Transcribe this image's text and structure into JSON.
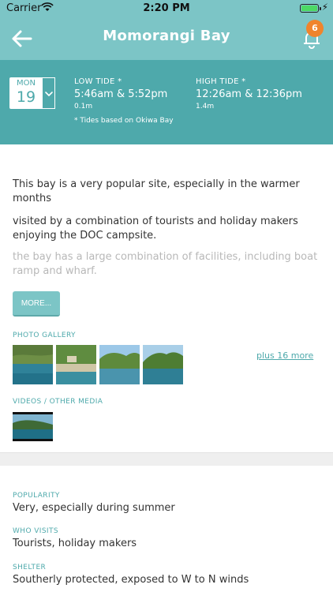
{
  "status_bar": {
    "carrier": "Carrier",
    "time": "2:20 PM"
  },
  "nav": {
    "title": "Momorangi Bay",
    "notification_count": "6"
  },
  "tide": {
    "date_month": "MON",
    "date_day": "19",
    "low_label": "LOW TIDE *",
    "low_times": "5:46am & 5:52pm",
    "low_height": "0.1m",
    "high_label": "HIGH TIDE *",
    "high_times": "12:26am & 12:36pm",
    "high_height": "1.4m",
    "note": "* Tides based on Okiwa Bay"
  },
  "description": {
    "p1": "This bay is a very popular site, especially in the warmer months",
    "p2": "visited by a combination of tourists and holiday makers enjoying the DOC campsite.",
    "p3": "the bay has a large combination of facilities, including boat ramp and wharf."
  },
  "more_button": "MORE...",
  "photo_gallery": {
    "label": "PHOTO GALLERY",
    "more_link": "plus 16 more"
  },
  "videos": {
    "label": "VIDEOS / OTHER MEDIA"
  },
  "info": {
    "popularity_label": "POPULARITY",
    "popularity_value": "Very, especially during summer",
    "who_visits_label": "WHO VISITS",
    "who_visits_value": "Tourists, holiday makers",
    "shelter_label": "SHELTER",
    "shelter_value": "Southerly protected, exposed to W to N winds"
  },
  "colors": {
    "header": "#7cc5c6",
    "tide_panel": "#4ea9ab",
    "badge": "#f0842c",
    "accent": "#4ea9ab"
  }
}
